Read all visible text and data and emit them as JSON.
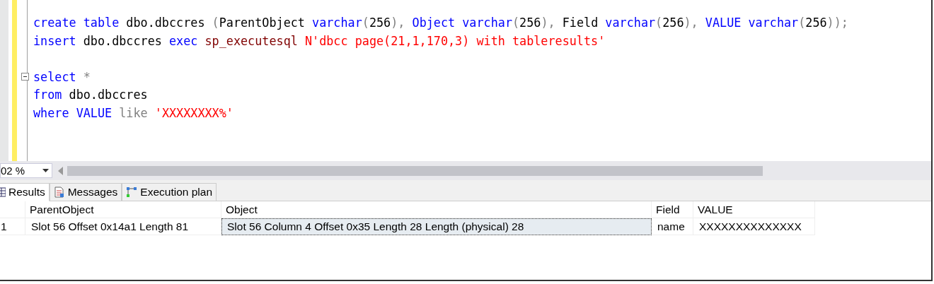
{
  "editor": {
    "lines": [
      {
        "kind": "code",
        "tokens": [
          {
            "kind": "keyword",
            "text": "create"
          },
          {
            "kind": "keyword",
            "text": " table"
          },
          {
            "kind": "plain",
            "text": " dbo.dbccres "
          },
          {
            "kind": "operator",
            "text": "("
          },
          {
            "kind": "plain",
            "text": "ParentObject "
          },
          {
            "kind": "keyword",
            "text": "varchar"
          },
          {
            "kind": "operator",
            "text": "("
          },
          {
            "kind": "plain",
            "text": "256"
          },
          {
            "kind": "operator",
            "text": "),"
          },
          {
            "kind": "keyword",
            "text": " Object"
          },
          {
            "kind": "keyword",
            "text": " varchar"
          },
          {
            "kind": "operator",
            "text": "("
          },
          {
            "kind": "plain",
            "text": "256"
          },
          {
            "kind": "operator",
            "text": "),"
          },
          {
            "kind": "plain",
            "text": " Field "
          },
          {
            "kind": "keyword",
            "text": "varchar"
          },
          {
            "kind": "operator",
            "text": "("
          },
          {
            "kind": "plain",
            "text": "256"
          },
          {
            "kind": "operator",
            "text": "),"
          },
          {
            "kind": "keyword",
            "text": " VALUE"
          },
          {
            "kind": "keyword",
            "text": " varchar"
          },
          {
            "kind": "operator",
            "text": "("
          },
          {
            "kind": "plain",
            "text": "256"
          },
          {
            "kind": "operator",
            "text": "));"
          }
        ]
      },
      {
        "kind": "code",
        "tokens": [
          {
            "kind": "keyword",
            "text": "insert"
          },
          {
            "kind": "plain",
            "text": " dbo.dbccres "
          },
          {
            "kind": "keyword",
            "text": "exec"
          },
          {
            "kind": "procedure",
            "text": " sp_executesql"
          },
          {
            "kind": "string",
            "text": " N'dbcc page(21,1,170,3) with tableresults'"
          }
        ]
      },
      {
        "kind": "blank"
      },
      {
        "kind": "code",
        "fold": true,
        "tokens": [
          {
            "kind": "keyword",
            "text": "select"
          },
          {
            "kind": "operator",
            "text": " *"
          }
        ]
      },
      {
        "kind": "code",
        "tokens": [
          {
            "kind": "keyword",
            "text": "from"
          },
          {
            "kind": "plain",
            "text": " dbo.dbccres"
          }
        ]
      },
      {
        "kind": "code",
        "tokens": [
          {
            "kind": "keyword",
            "text": "where"
          },
          {
            "kind": "keyword",
            "text": " VALUE"
          },
          {
            "kind": "operator",
            "text": " like"
          },
          {
            "kind": "string",
            "text": " 'XXXXXXXX%'"
          }
        ]
      }
    ]
  },
  "zoom": {
    "value": "02 %"
  },
  "tabs": [
    {
      "label": "Results",
      "selected": true
    },
    {
      "label": "Messages",
      "selected": false
    },
    {
      "label": "Execution plan",
      "selected": false
    }
  ],
  "grid": {
    "columns": [
      "ParentObject",
      "Object",
      "Field",
      "VALUE"
    ],
    "rows": [
      {
        "number": "1",
        "cells": [
          {
            "text": "Slot 56 Offset 0x14a1 Length 81",
            "selected": false
          },
          {
            "text": "Slot 56 Column 4 Offset 0x35 Length 28 Length (physical) 28",
            "selected": true
          },
          {
            "text": "name",
            "selected": false
          },
          {
            "text": "XXXXXXXXXXXXXX",
            "selected": false
          }
        ]
      }
    ]
  }
}
